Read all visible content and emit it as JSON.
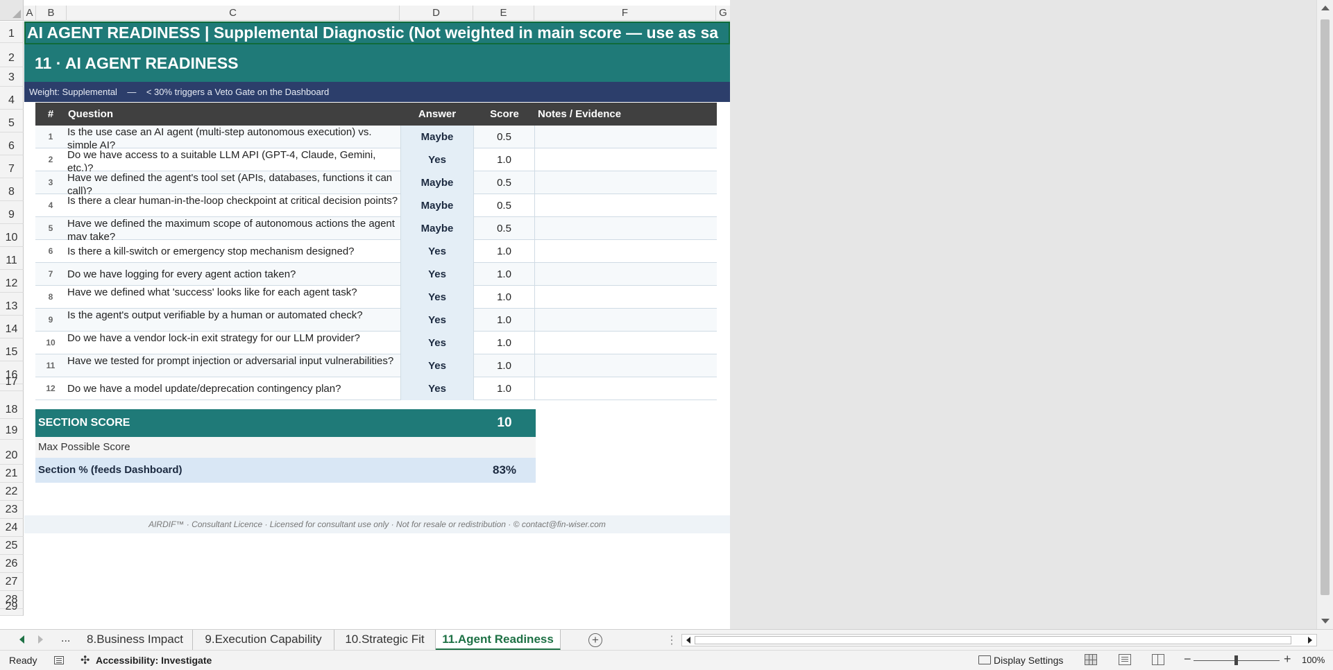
{
  "columns": [
    "A",
    "B",
    "C",
    "D",
    "E",
    "F",
    "G"
  ],
  "rows": [
    "1",
    "2",
    "3",
    "4",
    "5",
    "6",
    "7",
    "8",
    "9",
    "10",
    "11",
    "12",
    "13",
    "14",
    "15",
    "16",
    "17",
    "18",
    "19",
    "20",
    "21",
    "22",
    "23",
    "24",
    "25",
    "26",
    "27",
    "28",
    "29"
  ],
  "sheet": {
    "title": "AI AGENT READINESS  |  Supplemental Diagnostic  (Not weighted in main score — use as sa",
    "section_heading": "11  ·  AI AGENT READINESS",
    "weight_note": "Weight: Supplemental    —    < 30% triggers a Veto Gate on the Dashboard",
    "table_headers": {
      "num": "#",
      "question": "Question",
      "answer": "Answer",
      "score": "Score",
      "notes": "Notes / Evidence"
    },
    "questions": [
      {
        "num": "1",
        "text": "Is the use case an AI agent (multi-step autonomous execution) vs. simple AI?",
        "answer": "Maybe",
        "score": "0.5"
      },
      {
        "num": "2",
        "text": "Do we have access to a suitable LLM API (GPT-4, Claude, Gemini, etc.)?",
        "answer": "Yes",
        "score": "1.0"
      },
      {
        "num": "3",
        "text": "Have we defined the agent's tool set (APIs, databases, functions it can call)?",
        "answer": "Maybe",
        "score": "0.5"
      },
      {
        "num": "4",
        "text": "Is there a clear human-in-the-loop checkpoint at critical decision points?",
        "answer": "Maybe",
        "score": "0.5"
      },
      {
        "num": "5",
        "text": "Have we defined the maximum scope of autonomous actions the agent may take?",
        "answer": "Maybe",
        "score": "0.5"
      },
      {
        "num": "6",
        "text": "Is there a kill-switch or emergency stop mechanism designed?",
        "answer": "Yes",
        "score": "1.0"
      },
      {
        "num": "7",
        "text": "Do we have logging for every agent action taken?",
        "answer": "Yes",
        "score": "1.0"
      },
      {
        "num": "8",
        "text": "Have we defined what 'success' looks like for each agent task?",
        "answer": "Yes",
        "score": "1.0"
      },
      {
        "num": "9",
        "text": "Is the agent's output verifiable by a human or automated check?",
        "answer": "Yes",
        "score": "1.0"
      },
      {
        "num": "10",
        "text": "Do we have a vendor lock-in exit strategy for our LLM provider?",
        "answer": "Yes",
        "score": "1.0"
      },
      {
        "num": "11",
        "text": "Have we tested for prompt injection or adversarial input vulnerabilities?",
        "answer": "Yes",
        "score": "1.0"
      },
      {
        "num": "12",
        "text": "Do we have a model update/deprecation contingency plan?",
        "answer": "Yes",
        "score": "1.0"
      }
    ],
    "section_score_label": "SECTION SCORE",
    "section_score_value": "10",
    "max_score_label": "Max Possible Score",
    "section_pct_label": "Section %  (feeds Dashboard)",
    "section_pct_value": "83%",
    "footer": "AIRDIF™  ·  Consultant Licence  ·  Licensed for consultant use only  ·  Not for resale or redistribution  ·  © contact@fin-wiser.com"
  },
  "tabs": {
    "more": "...",
    "items": [
      "8.Business Impact",
      "9.Execution Capability",
      "10.Strategic Fit",
      "11.Agent Readiness"
    ],
    "active": "11.Agent Readiness",
    "add_symbol": "+"
  },
  "status": {
    "ready": "Ready",
    "accessibility": "Accessibility: Investigate",
    "display_settings": "Display Settings",
    "zoom": "100%"
  },
  "colors": {
    "teal": "#1f7a78",
    "navy": "#2c3e6b",
    "header_dark": "#404040",
    "excel_green": "#1e7145"
  }
}
